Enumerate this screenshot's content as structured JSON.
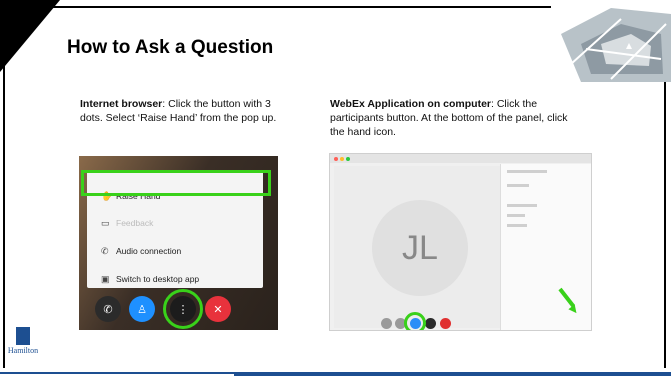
{
  "slide": {
    "title": "How to Ask a Question",
    "left": {
      "bold": "Internet browser",
      "text": ": Click the button with 3 dots. Select ‘Raise Hand’ from the pop up.",
      "menu": [
        "Raise Hand",
        "Feedback",
        "Audio connection",
        "Switch to desktop app"
      ]
    },
    "right": {
      "bold": "WebEx Application on computer",
      "text": ": Click the participants button. At the bottom of the panel, click the hand icon.",
      "avatar_initials": "JL"
    },
    "logo_text": "Hamilton"
  },
  "colors": {
    "highlight": "#39d11a",
    "brand": "#1d4f91"
  }
}
